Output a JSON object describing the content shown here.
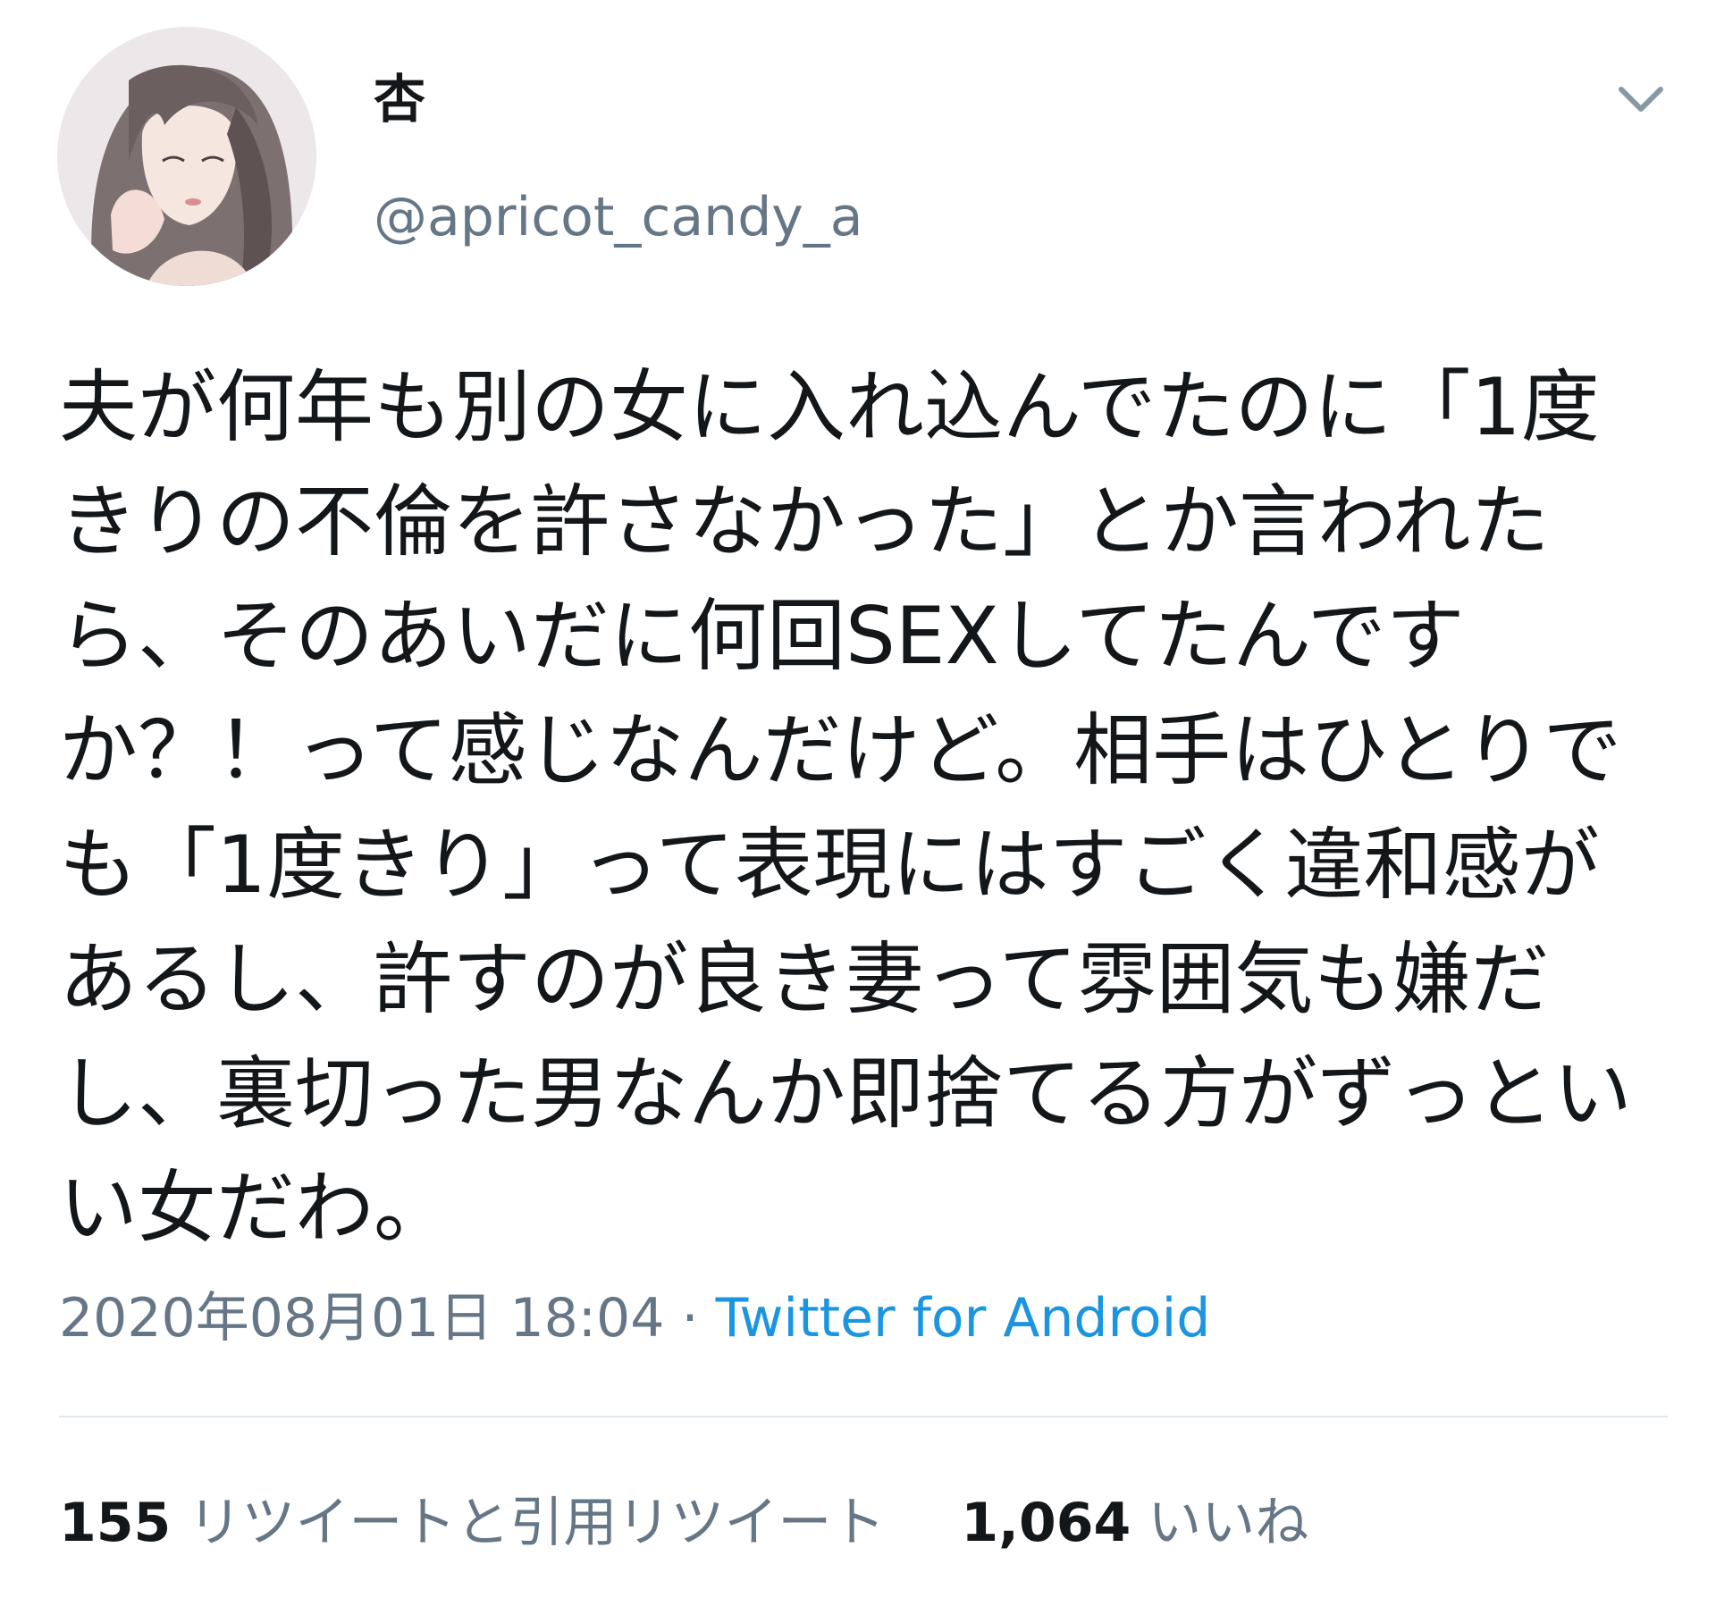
{
  "author": {
    "display_name": "杏",
    "handle": "@apricot_candy_a",
    "avatar_icon": "illustrated-portrait-avatar"
  },
  "menu_icon": "chevron-down-icon",
  "tweet": {
    "text": "夫が何年も別の女に入れ込んでたのに「1度きりの不倫を許さなかった」とか言われたら、そのあいだに何回SEXしてたんですか？！って感じなんだけど。相手はひとりでも「1度きり」って表現にはすごく違和感があるし、許すのが良き妻って雰囲気も嫌だし、裏切った男なんか即捨てる方がずっといい女だわ。",
    "date": "2020年08月01日 18:04",
    "separator": "·",
    "source": "Twitter for Android"
  },
  "stats": {
    "retweets_count": "155",
    "retweets_label": "リツイートと引用リツイート",
    "likes_count": "1,064",
    "likes_label": "いいね"
  },
  "colors": {
    "text": "#14171a",
    "secondary": "#657786",
    "link": "#1b95e0",
    "divider": "#e1e8ed"
  }
}
